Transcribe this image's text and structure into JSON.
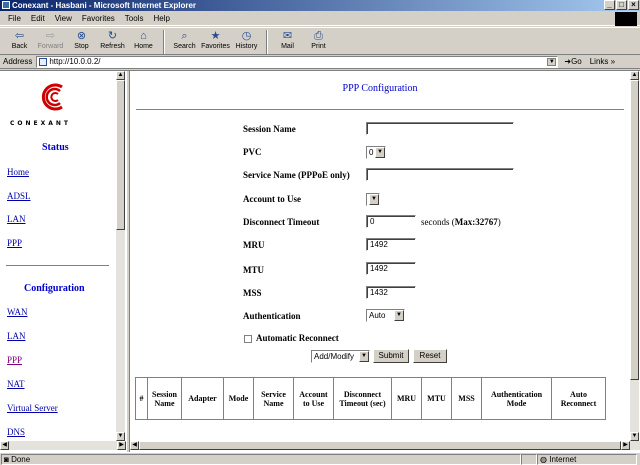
{
  "window": {
    "title": "Conexant - Hasbani - Microsoft Internet Explorer"
  },
  "menu": [
    "File",
    "Edit",
    "View",
    "Favorites",
    "Tools",
    "Help"
  ],
  "toolbar": {
    "back": "Back",
    "forward": "Forward",
    "stop": "Stop",
    "refresh": "Refresh",
    "home": "Home",
    "search": "Search",
    "favorites": "Favorites",
    "history": "History",
    "mail": "Mail",
    "print": "Print"
  },
  "address": {
    "label": "Address",
    "url": "http://10.0.0.2/",
    "go": "Go",
    "links": "Links"
  },
  "sidebar": {
    "brand": "CONEXANT",
    "status_heading": "Status",
    "status_items": [
      "Home",
      "ADSL",
      "LAN",
      "PPP"
    ],
    "config_heading": "Configuration",
    "config_items": [
      "WAN",
      "LAN",
      "PPP",
      "NAT",
      "Virtual Server",
      "DNS"
    ]
  },
  "main": {
    "title": "PPP Configuration",
    "fields": {
      "session_name": {
        "label": "Session Name",
        "value": ""
      },
      "pvc": {
        "label": "PVC",
        "value": "0"
      },
      "service_name": {
        "label": "Service Name (PPPoE only)",
        "value": ""
      },
      "account": {
        "label": "Account to Use",
        "value": ""
      },
      "disconnect_timeout": {
        "label": "Disconnect Timeout",
        "value": "0",
        "unit": "seconds (",
        "max": "Max:32767",
        "close": ")"
      },
      "mru": {
        "label": "MRU",
        "value": "1492"
      },
      "mtu": {
        "label": "MTU",
        "value": "1492"
      },
      "mss": {
        "label": "MSS",
        "value": "1432"
      },
      "authentication": {
        "label": "Authentication",
        "value": "Auto"
      },
      "auto_reconnect": {
        "label": "Automatic Reconnect",
        "checked": false
      }
    },
    "action_select": "Add/Modify",
    "submit": "Submit",
    "reset": "Reset",
    "table_headers": [
      "#",
      "Session Name",
      "Adapter",
      "Mode",
      "Service Name",
      "Account to Use",
      "Disconnect Timeout (sec)",
      "MRU",
      "MTU",
      "MSS",
      "Authentication Mode",
      "Auto Reconnect"
    ]
  },
  "status": {
    "left": "Done",
    "zone": "Internet"
  }
}
